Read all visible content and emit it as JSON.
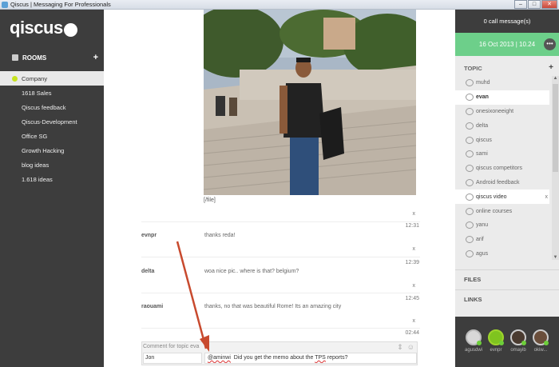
{
  "window": {
    "title": "Qiscus | Messaging For Professionals",
    "buttons": [
      "–",
      "□",
      "✕"
    ]
  },
  "sidebar": {
    "logo": "qiscus",
    "rooms_label": "ROOMS",
    "add_label": "+",
    "rooms": [
      {
        "label": "Company",
        "active": true
      },
      {
        "label": "1618 Sales"
      },
      {
        "label": "Qiscus feedback"
      },
      {
        "label": "Qiscus-Development"
      },
      {
        "label": "Office SG"
      },
      {
        "label": "Growth Hacking"
      },
      {
        "label": "blog ideas"
      },
      {
        "label": "1.618 ideas"
      }
    ]
  },
  "chat": {
    "file_tag": "[/file]",
    "close_glyph": "x",
    "messages": [
      {
        "time": "12:31",
        "author": "evnpr",
        "text": "thanks reda!"
      },
      {
        "time": "12:39",
        "author": "delta",
        "text": "woa nice pic.. where is that? belgium?"
      },
      {
        "time": "12:45",
        "author": "raouami",
        "text": "thanks, no that was beautiful Rome! Its an amazing city"
      },
      {
        "time": "02:44",
        "author": "",
        "text": ""
      }
    ],
    "composer": {
      "label": "Comment for topic eva",
      "name_value": "Jon",
      "mention": "@aminwi",
      "text_mid": "  Did you get the memo about the ",
      "tps": "TPS",
      "text_end": " reports?"
    }
  },
  "right": {
    "calls": "0 call message(s)",
    "date": "16 Oct 2013 | 10.24",
    "more_glyph": "•••",
    "topic_label": "TOPIC",
    "add_label": "+",
    "topics": [
      {
        "label": "muhd"
      },
      {
        "label": "evan",
        "active": true
      },
      {
        "label": "onesixoneeight"
      },
      {
        "label": "delta"
      },
      {
        "label": "qiscus"
      },
      {
        "label": "sami"
      },
      {
        "label": "qiscus competitors"
      },
      {
        "label": "Android feedback"
      },
      {
        "label": "qiscus video",
        "x": true
      },
      {
        "label": "online courses"
      },
      {
        "label": "yanu"
      },
      {
        "label": "arif"
      },
      {
        "label": "agus"
      }
    ],
    "files_label": "FILES",
    "links_label": "LINKS",
    "people": [
      "agusdwi",
      "evnpr",
      "omayib",
      "okiw..."
    ]
  }
}
